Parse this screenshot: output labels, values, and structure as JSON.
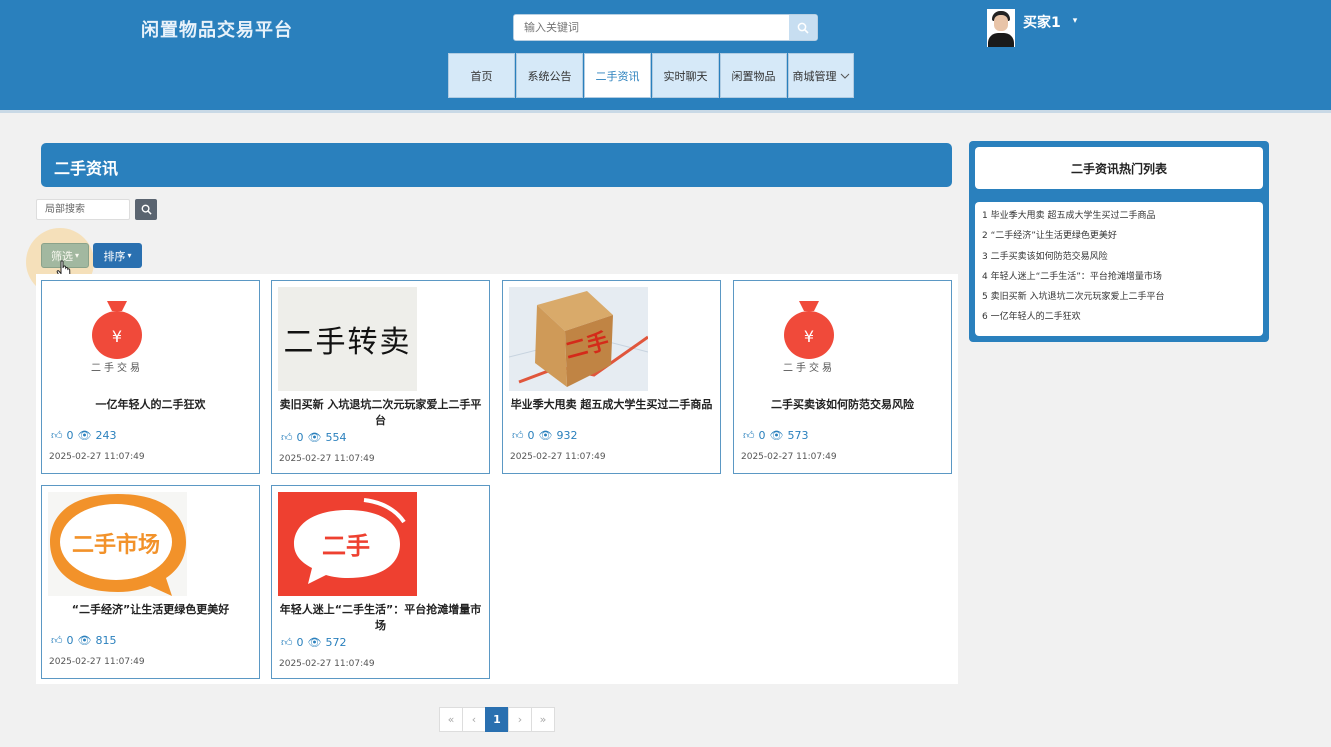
{
  "header": {
    "site_title": "闲置物品交易平台",
    "search_placeholder": "输入关键词",
    "username": "买家1",
    "nav": [
      {
        "label": "首页"
      },
      {
        "label": "系统公告"
      },
      {
        "label": "二手资讯",
        "active": true
      },
      {
        "label": "实时聊天"
      },
      {
        "label": "闲置物品"
      },
      {
        "label": "商城管理"
      }
    ]
  },
  "main": {
    "section_title": "二手资讯",
    "local_search_placeholder": "局部搜索",
    "filter_label": "筛选",
    "sort_label": "排序",
    "cards": [
      {
        "title": "一亿年轻人的二手狂欢",
        "likes": "0",
        "views": "243",
        "date": "2025-02-27 11:07:49",
        "image": "moneybag"
      },
      {
        "title": "卖旧买新 入坑退坑二次元玩家爱上二手平台",
        "likes": "0",
        "views": "554",
        "date": "2025-02-27 11:07:49",
        "image": "calligraphy"
      },
      {
        "title": "毕业季大甩卖 超五成大学生买过二手商品",
        "likes": "0",
        "views": "932",
        "date": "2025-02-27 11:07:49",
        "image": "box"
      },
      {
        "title": "二手买卖该如何防范交易风险",
        "likes": "0",
        "views": "573",
        "date": "2025-02-27 11:07:49",
        "image": "moneybag"
      },
      {
        "title": "“二手经济”让生活更绿色更美好",
        "likes": "0",
        "views": "815",
        "date": "2025-02-27 11:07:49",
        "image": "market"
      },
      {
        "title": "年轻人迷上“二手生活”：平台抢滩增量市场",
        "likes": "0",
        "views": "572",
        "date": "2025-02-27 11:07:49",
        "image": "bubble"
      }
    ],
    "image_texts": {
      "moneybag_caption": "二手交易",
      "yen": "¥",
      "calligraphy": "二手转卖",
      "box": "二手",
      "market": "二手市场",
      "bubble": "二手"
    }
  },
  "sidebar": {
    "title": "二手资讯热门列表",
    "items": [
      "1  毕业季大甩卖 超五成大学生买过二手商品",
      "2  “二手经济”让生活更绿色更美好",
      "3  二手买卖该如何防范交易风险",
      "4  年轻人迷上“二手生活”：平台抢滩增量市场",
      "5  卖旧买新 入坑退坑二次元玩家爱上二手平台",
      "6  一亿年轻人的二手狂欢"
    ]
  },
  "pagination": {
    "first": "«",
    "prev": "‹",
    "current": "1",
    "next": "›",
    "last": "»"
  },
  "colors": {
    "primary": "#2a80bd",
    "card_border": "#5b98c4",
    "accent_red": "#e8442c",
    "accent_orange": "#f39a2a"
  }
}
